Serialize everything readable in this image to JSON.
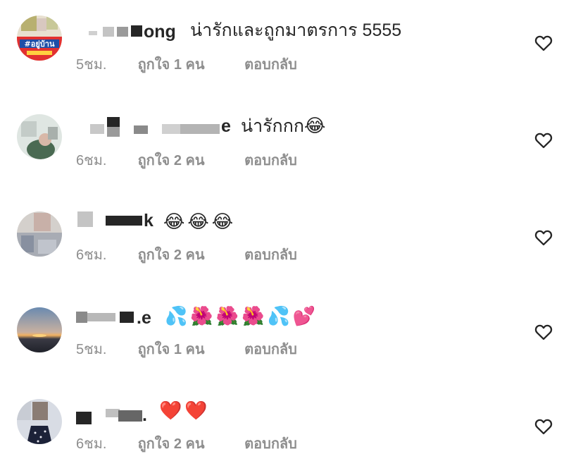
{
  "comments": [
    {
      "username_visible": "ong",
      "text": "น่ารักและถูกมาตรการ 5555",
      "emoji": "",
      "time": "5ชม.",
      "likes": "ถูกใจ 1 คน",
      "reply": "ตอบกลับ",
      "avatar_badge": "#อยู่บ้าน"
    },
    {
      "username_visible": "e",
      "text": "น่ารักกก",
      "emoji": "😂",
      "time": "6ชม.",
      "likes": "ถูกใจ 2 คน",
      "reply": "ตอบกลับ"
    },
    {
      "username_visible": "k",
      "text": "",
      "emoji": "😂😂😂",
      "time": "6ชม.",
      "likes": "ถูกใจ 2 คน",
      "reply": "ตอบกลับ"
    },
    {
      "username_visible": ".e",
      "text": "",
      "emoji": "💦🌺🌺🌺💦💕",
      "time": "5ชม.",
      "likes": "ถูกใจ 1 คน",
      "reply": "ตอบกลับ"
    },
    {
      "username_visible": ".",
      "text": "",
      "emoji": "❤️❤️",
      "time": "6ชม.",
      "likes": "ถูกใจ 2 คน",
      "reply": "ตอบกลับ"
    }
  ],
  "colors": {
    "text": "#262626",
    "meta": "#8e8e8e",
    "heart_stroke": "#262626"
  },
  "icons": {
    "like": "heart-outline-icon"
  }
}
